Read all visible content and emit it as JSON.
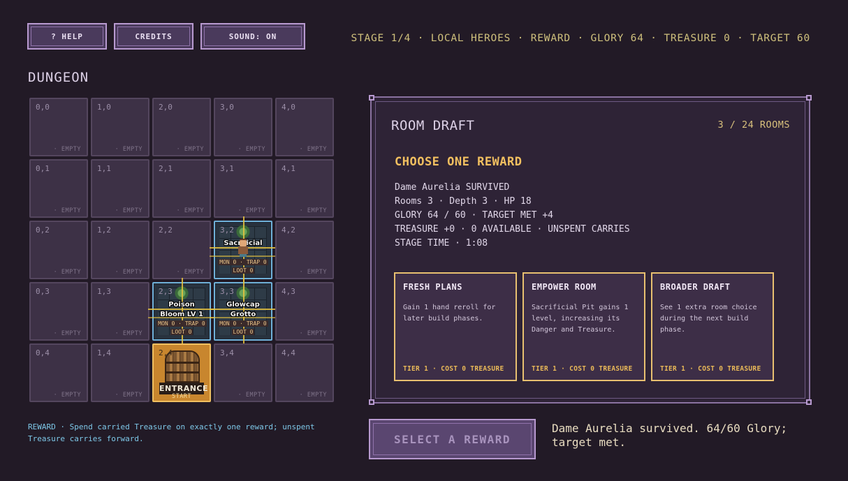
{
  "toolbar": {
    "help_label": "? HELP",
    "credits_label": "CREDITS",
    "sound_label": "SOUND: ON"
  },
  "stats_line": "STAGE 1/4 · LOCAL HEROES · REWARD · GLORY 64 · TREASURE 0 · TARGET 60",
  "dungeon": {
    "title": "DUNGEON",
    "empty_label": "· EMPTY",
    "cells": [
      {
        "coord": "0,0",
        "col": 0,
        "row": 0,
        "type": "empty"
      },
      {
        "coord": "1,0",
        "col": 1,
        "row": 0,
        "type": "empty"
      },
      {
        "coord": "2,0",
        "col": 2,
        "row": 0,
        "type": "empty"
      },
      {
        "coord": "3,0",
        "col": 3,
        "row": 0,
        "type": "empty"
      },
      {
        "coord": "4,0",
        "col": 4,
        "row": 0,
        "type": "empty"
      },
      {
        "coord": "0,1",
        "col": 0,
        "row": 1,
        "type": "empty"
      },
      {
        "coord": "1,1",
        "col": 1,
        "row": 1,
        "type": "empty"
      },
      {
        "coord": "2,1",
        "col": 2,
        "row": 1,
        "type": "empty"
      },
      {
        "coord": "3,1",
        "col": 3,
        "row": 1,
        "type": "empty"
      },
      {
        "coord": "4,1",
        "col": 4,
        "row": 1,
        "type": "empty"
      },
      {
        "coord": "0,2",
        "col": 0,
        "row": 2,
        "type": "empty"
      },
      {
        "coord": "1,2",
        "col": 1,
        "row": 2,
        "type": "empty"
      },
      {
        "coord": "2,2",
        "col": 2,
        "row": 2,
        "type": "empty"
      },
      {
        "coord": "3,2",
        "col": 3,
        "row": 2,
        "type": "room",
        "name": "Sacrificial",
        "info": "MON 0 · TRAP 0",
        "loot": "LOOT 0",
        "hero": true
      },
      {
        "coord": "4,2",
        "col": 4,
        "row": 2,
        "type": "empty"
      },
      {
        "coord": "0,3",
        "col": 0,
        "row": 3,
        "type": "empty"
      },
      {
        "coord": "1,3",
        "col": 1,
        "row": 3,
        "type": "empty"
      },
      {
        "coord": "2,3",
        "col": 2,
        "row": 3,
        "type": "room",
        "name": "Poison Bloom LV 1",
        "info": "MON 0 · TRAP 0",
        "loot": "LOOT 0",
        "hero": false
      },
      {
        "coord": "3,3",
        "col": 3,
        "row": 3,
        "type": "room",
        "name": "Glowcap Grotto",
        "info": "MON 0 · TRAP 0",
        "loot": "LOOT 0",
        "hero": false
      },
      {
        "coord": "4,3",
        "col": 4,
        "row": 3,
        "type": "empty"
      },
      {
        "coord": "0,4",
        "col": 0,
        "row": 4,
        "type": "empty"
      },
      {
        "coord": "1,4",
        "col": 1,
        "row": 4,
        "type": "empty"
      },
      {
        "coord": "2,4",
        "col": 2,
        "row": 4,
        "type": "entrance",
        "name": "ENTRANCE",
        "sub": "START"
      },
      {
        "coord": "3,4",
        "col": 3,
        "row": 4,
        "type": "empty"
      },
      {
        "coord": "4,4",
        "col": 4,
        "row": 4,
        "type": "empty"
      }
    ]
  },
  "footnote": "REWARD · Spend carried Treasure on exactly one reward; unspent Treasure carries forward.",
  "draft": {
    "title": "ROOM DRAFT",
    "count": "3 / 24 ROOMS",
    "heading": "CHOOSE ONE REWARD",
    "summary": [
      "Dame Aurelia SURVIVED",
      "Rooms 3 · Depth 3 · HP 18",
      "GLORY 64 / 60 · TARGET MET +4",
      "TREASURE +0 · 0 AVAILABLE · UNSPENT CARRIES",
      "STAGE TIME · 1:08"
    ],
    "cards": [
      {
        "title": "FRESH PLANS",
        "desc": "Gain 1 hand reroll for later build phases.",
        "tier": "TIER 1 · COST 0 TREASURE"
      },
      {
        "title": "EMPOWER ROOM",
        "desc": "Sacrificial Pit gains 1 level, increasing its Danger and Treasure.",
        "tier": "TIER 1 · COST 0 TREASURE"
      },
      {
        "title": "BROADER DRAFT",
        "desc": "See 1 extra room choice during the next build phase.",
        "tier": "TIER 1 · COST 0 TREASURE"
      }
    ]
  },
  "select_label": "SELECT A REWARD",
  "outcome": "Dame Aurelia survived. 64/60 Glory; target met."
}
